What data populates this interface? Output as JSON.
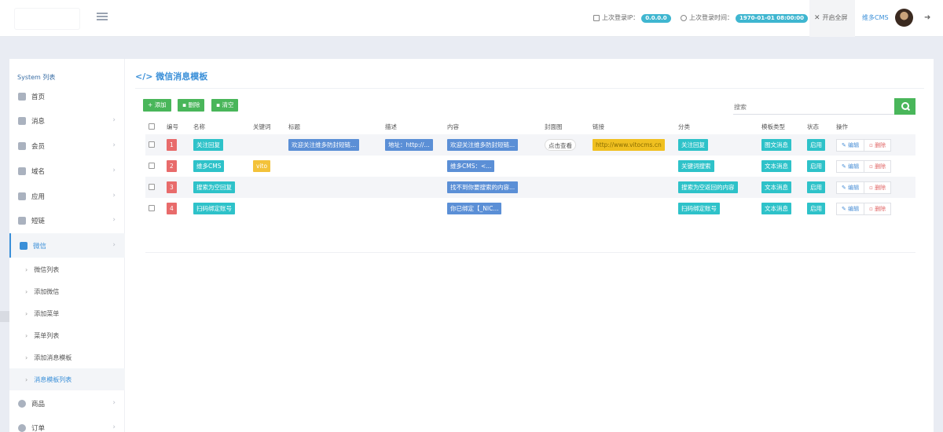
{
  "topbar": {
    "last_ip_label": "上次登录IP：",
    "last_ip_value": "0.0.0.0",
    "last_time_label": "上次登录时间：",
    "last_time_value": "1970-01-01 08:00:00",
    "fullscreen_label": "开启全屏",
    "user_name": "维多CMS",
    "colors": {
      "pill": "#3fb6d0"
    }
  },
  "sidebar": {
    "heading": "System 列表",
    "items": [
      {
        "label": "首页",
        "icon": "home-icon"
      },
      {
        "label": "消息",
        "icon": "document-icon"
      },
      {
        "label": "会员",
        "icon": "member-icon"
      },
      {
        "label": "域名",
        "icon": "link-icon"
      },
      {
        "label": "应用",
        "icon": "gift-icon"
      },
      {
        "label": "短链",
        "icon": "link-icon"
      },
      {
        "label": "微信",
        "icon": "wechat-icon"
      }
    ],
    "wechat_sub": [
      {
        "label": "微信列表"
      },
      {
        "label": "添加微信"
      },
      {
        "label": "添加菜单"
      },
      {
        "label": "菜单列表"
      },
      {
        "label": "添加消息模板"
      },
      {
        "label": "消息模板列表"
      }
    ],
    "bottom_items": [
      {
        "label": "商品",
        "icon": "product-icon"
      },
      {
        "label": "订单",
        "icon": "order-icon"
      }
    ]
  },
  "main": {
    "title": "微信消息模板",
    "toolbar": {
      "add": "添加",
      "delete": "删除",
      "clear": "清空"
    },
    "search": {
      "placeholder": "搜索"
    },
    "columns": [
      "编号",
      "名称",
      "关键词",
      "标题",
      "描述",
      "内容",
      "封面图",
      "链接",
      "分类",
      "模板类型",
      "状态",
      "操作"
    ],
    "rows": [
      {
        "id": "1",
        "name": "关注回复",
        "keyword": "",
        "title": "欢迎关注维多防封短链...",
        "desc": "地址：http://...",
        "content": "欢迎关注维多防封短链...",
        "cover": "点击查看",
        "link": "http://www.vitocms.cn",
        "category": "关注回复",
        "type": "图文消息",
        "status": "启用",
        "edit": "编辑",
        "del": "删除"
      },
      {
        "id": "2",
        "name": "维多CMS",
        "keyword": "vito",
        "title": "",
        "desc": "",
        "content": "维多CMS：<...",
        "cover": "",
        "link": "",
        "category": "关键词搜索",
        "type": "文本消息",
        "status": "启用",
        "edit": "编辑",
        "del": "删除"
      },
      {
        "id": "3",
        "name": "搜索为空回复",
        "keyword": "",
        "title": "",
        "desc": "",
        "content": "找不到你要搜索的内容...",
        "cover": "",
        "link": "",
        "category": "搜索为空返回的内容",
        "type": "文本消息",
        "status": "启用",
        "edit": "编辑",
        "del": "删除"
      },
      {
        "id": "4",
        "name": "扫码绑定账号",
        "keyword": "",
        "title": "",
        "desc": "",
        "content": "你已绑定【_NIC...",
        "cover": "",
        "link": "",
        "category": "扫码绑定账号",
        "type": "文本消息",
        "status": "启用",
        "edit": "编辑",
        "del": "删除"
      }
    ]
  }
}
